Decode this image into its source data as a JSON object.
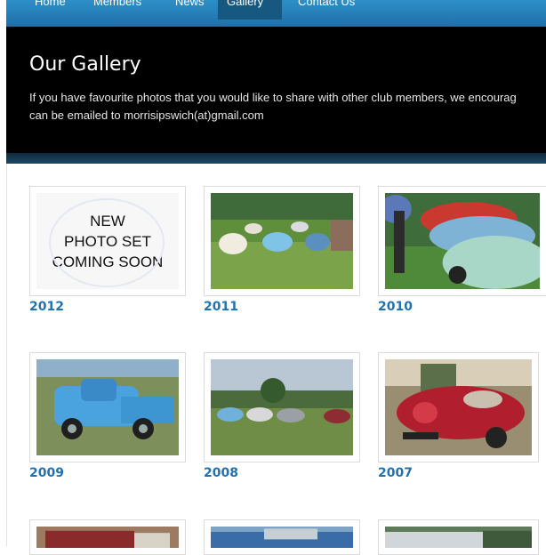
{
  "nav": {
    "items": [
      {
        "label": "Home"
      },
      {
        "label": "Members"
      },
      {
        "label": "News"
      },
      {
        "label": "Gallery",
        "active": true
      },
      {
        "label": "Contact Us"
      }
    ]
  },
  "header": {
    "title": "Our Gallery",
    "intro_line1": "If you have favourite photos that you would like to share with other club members, we encourag",
    "intro_line2": "can be emailed to morrisipswich(at)gmail.com"
  },
  "gallery": {
    "placeholder_lines": [
      "NEW",
      "PHOTO SET",
      "COMING SOON"
    ],
    "albums": [
      {
        "year": "2012"
      },
      {
        "year": "2011"
      },
      {
        "year": "2010"
      },
      {
        "year": "2009"
      },
      {
        "year": "2008"
      },
      {
        "year": "2007"
      }
    ]
  },
  "colors": {
    "nav": "#1f6fa6",
    "header_bg": "#000000",
    "link": "#1f72b3"
  }
}
